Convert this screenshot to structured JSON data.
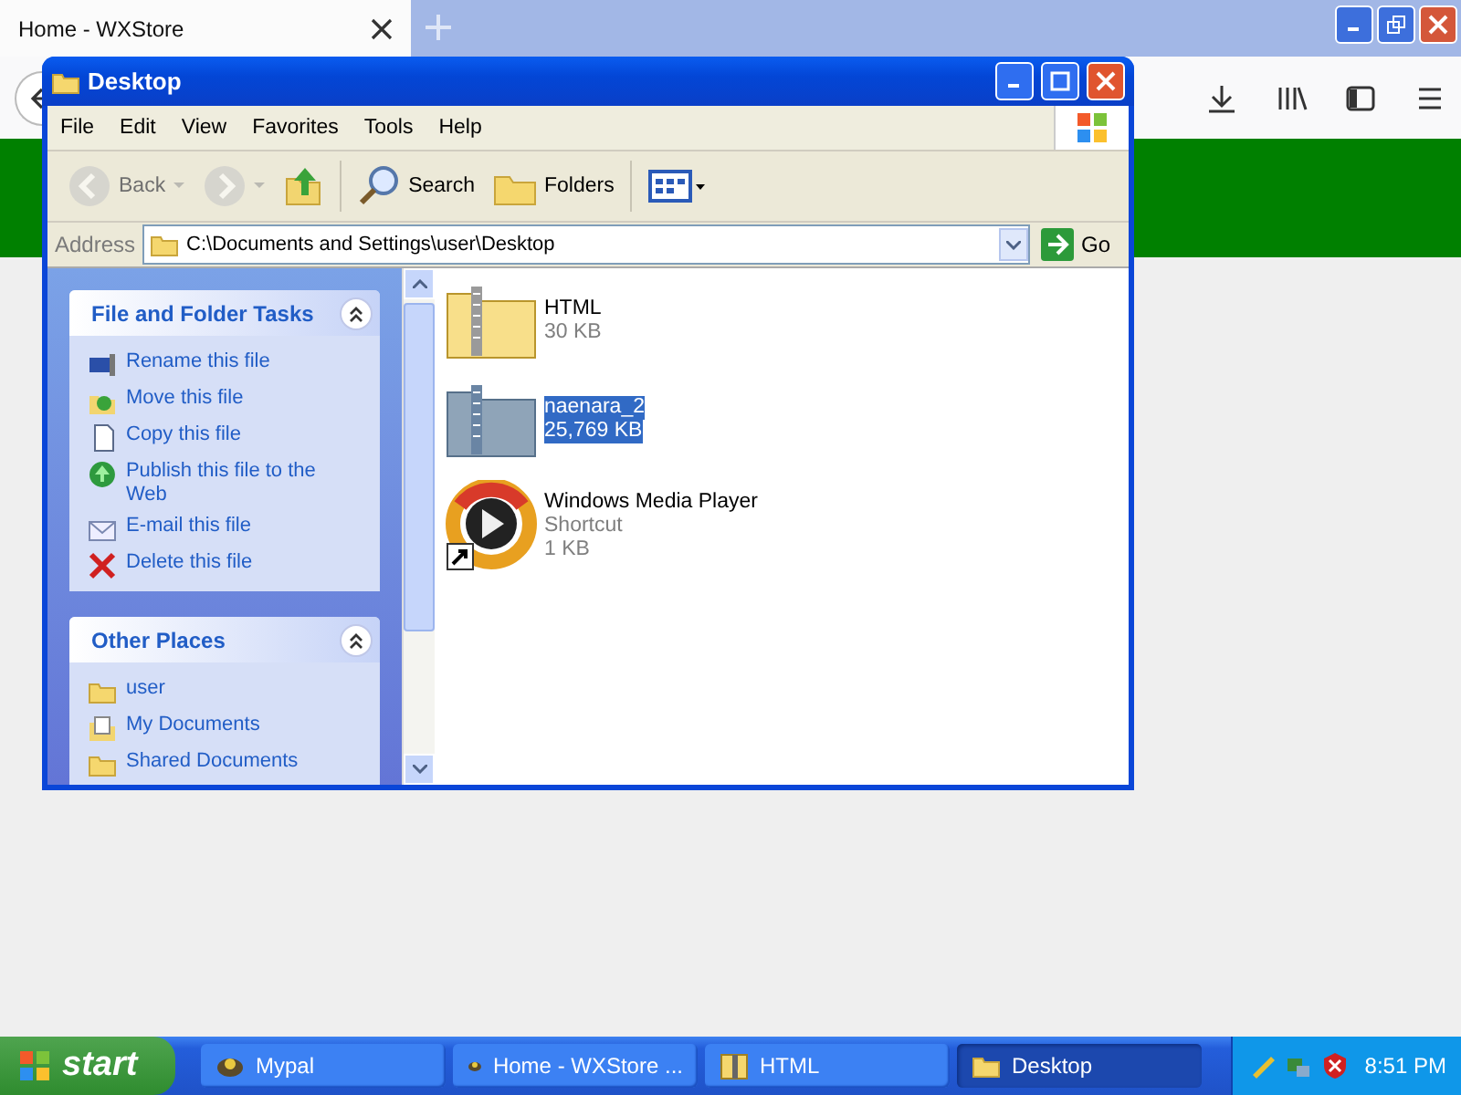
{
  "browser": {
    "tabs": [
      {
        "title": "Home - WXStore",
        "selected": true
      }
    ]
  },
  "explorer": {
    "title": "Desktop",
    "menu": [
      "File",
      "Edit",
      "View",
      "Favorites",
      "Tools",
      "Help"
    ],
    "toolbar": [
      {
        "kind": "back",
        "label": "Back",
        "disabled": true
      },
      {
        "kind": "forward",
        "disabled": true
      },
      {
        "kind": "up",
        "disabled": false
      },
      {
        "kind": "search",
        "label": "Search",
        "disabled": false
      },
      {
        "kind": "folders",
        "label": "Folders",
        "disabled": false
      },
      {
        "kind": "views",
        "disabled": false
      }
    ],
    "address": {
      "label": "Address",
      "value": "C:\\Documents and Settings\\user\\Desktop",
      "go": "Go"
    },
    "panels": [
      {
        "title": "File and Folder Tasks",
        "expanded": true,
        "items": [
          {
            "kind": "rename",
            "label": "Rename this file"
          },
          {
            "kind": "move",
            "label": "Move this file"
          },
          {
            "kind": "copy",
            "label": "Copy this file"
          },
          {
            "kind": "publish",
            "label": "Publish this file to the Web"
          },
          {
            "kind": "email",
            "label": "E-mail this file"
          },
          {
            "kind": "delete",
            "label": "Delete this file"
          }
        ]
      },
      {
        "title": "Other Places",
        "expanded": true,
        "items": [
          {
            "kind": "folder",
            "label": "user"
          },
          {
            "kind": "documents",
            "label": "My Documents"
          },
          {
            "kind": "folder",
            "label": "Shared Documents"
          }
        ]
      }
    ],
    "files": [
      {
        "kind": "zip",
        "name": "HTML",
        "details": [
          "30 KB"
        ],
        "selected": false
      },
      {
        "kind": "zip",
        "name": "naenara_2",
        "details": [
          "25,769 KB"
        ],
        "selected": true
      },
      {
        "kind": "shortcut",
        "name": "Windows Media Player",
        "details": [
          "Shortcut",
          "1 KB"
        ],
        "selected": false
      }
    ]
  },
  "taskbar": {
    "start": "start",
    "items": [
      {
        "kind": "app",
        "label": "Mypal",
        "selected": false
      },
      {
        "kind": "app",
        "label": "Home - WXStore ...",
        "selected": false
      },
      {
        "kind": "zip",
        "label": "HTML",
        "selected": false
      },
      {
        "kind": "folder",
        "label": "Desktop",
        "selected": true
      }
    ],
    "clock": "8:51 PM"
  }
}
